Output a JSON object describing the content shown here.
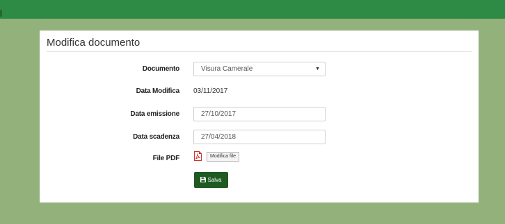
{
  "panel": {
    "title": "Modifica documento"
  },
  "form": {
    "documento": {
      "label": "Documento",
      "value": "Visura Camerale"
    },
    "data_modifica": {
      "label": "Data Modifica",
      "value": "03/11/2017"
    },
    "data_emissione": {
      "label": "Data emissione",
      "value": "27/10/2017"
    },
    "data_scadenza": {
      "label": "Data scadenza",
      "value": "27/04/2018"
    },
    "file_pdf": {
      "label": "File PDF",
      "button": "Modifica file",
      "icon": "pdf-file-icon"
    }
  },
  "actions": {
    "save_label": "Salva",
    "save_icon": "floppy-disk-icon"
  },
  "colors": {
    "topbar": "#2e8b45",
    "background": "#93b17a",
    "save_button": "#1f5a22",
    "pdf_icon": "#d0312d"
  }
}
